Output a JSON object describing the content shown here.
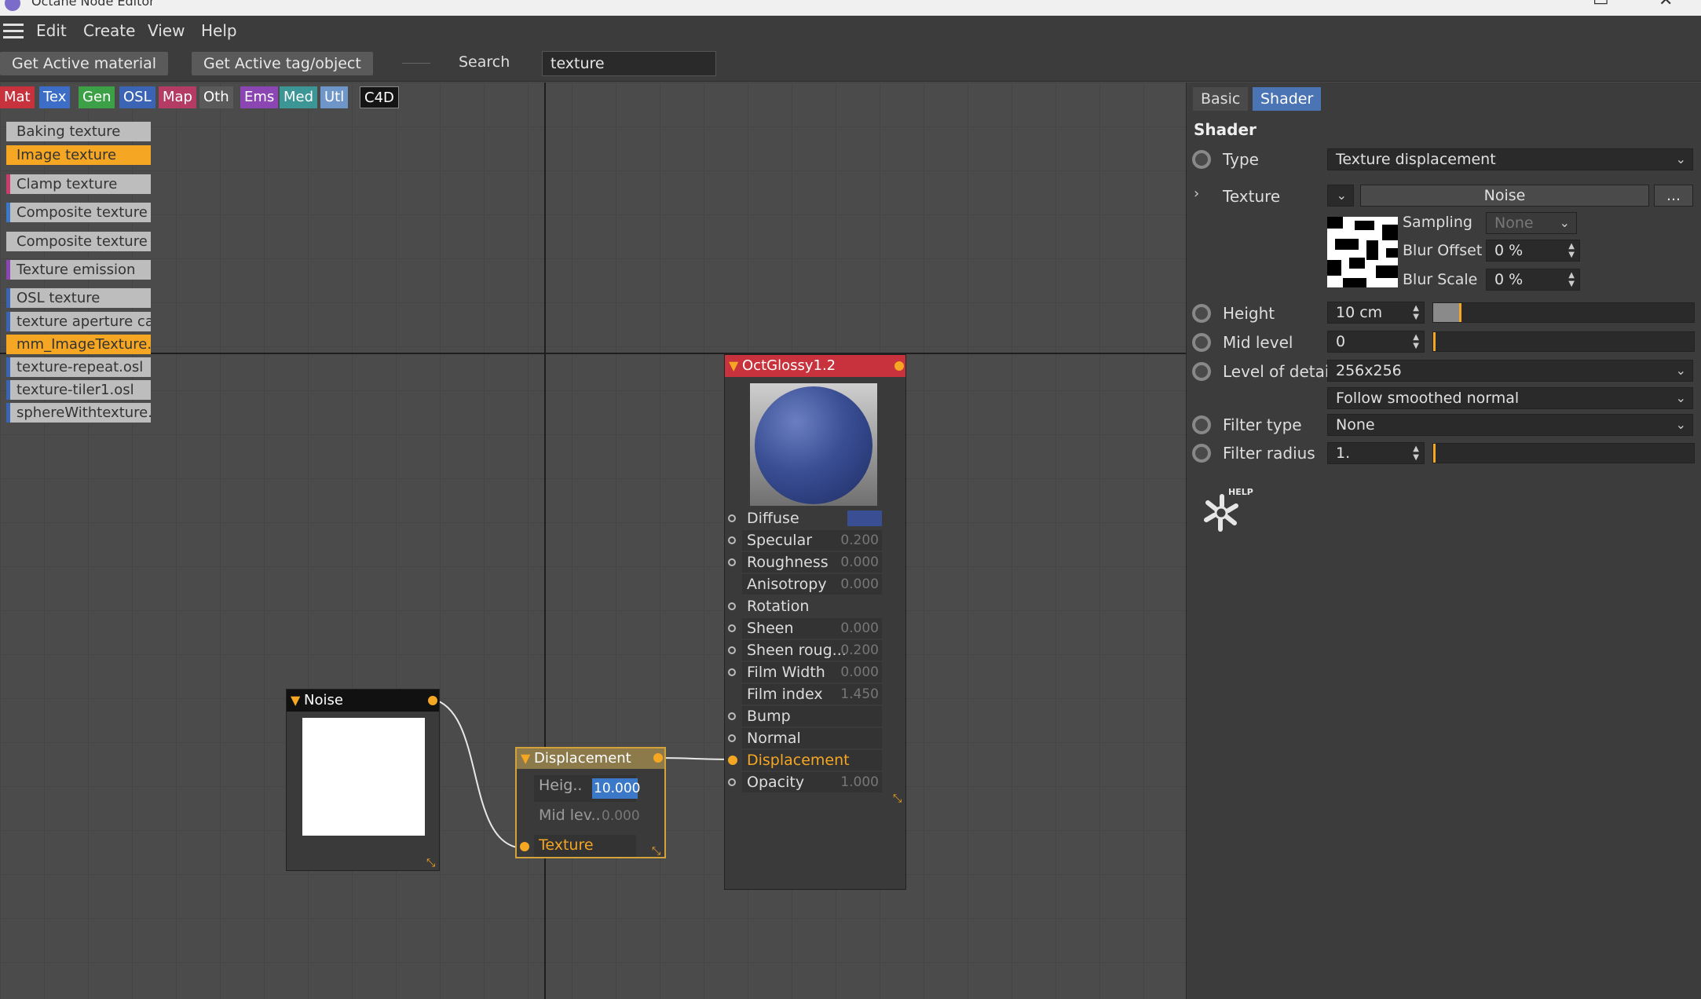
{
  "window": {
    "title": "Octane Node Editor"
  },
  "menu": [
    "Edit",
    "Create",
    "View",
    "Help"
  ],
  "toolbar": {
    "get_active_material": "Get Active material",
    "get_active_tag": "Get Active tag/object",
    "search_label": "Search",
    "search_value": "texture"
  },
  "categories": [
    {
      "label": "Mat",
      "color": "#c8323c"
    },
    {
      "label": "Tex",
      "color": "#3c6ec8"
    },
    {
      "label": "Gen",
      "color": "#3ca046"
    },
    {
      "label": "OSL",
      "color": "#3c64b4"
    },
    {
      "label": "Map",
      "color": "#b43c64"
    },
    {
      "label": "Oth",
      "color": "#5a5a5a"
    },
    {
      "label": "Ems",
      "color": "#8c46b4"
    },
    {
      "label": "Med",
      "color": "#3c9696"
    },
    {
      "label": "Utl",
      "color": "#6e96c8"
    },
    {
      "label": "C4D",
      "color": "#141414"
    }
  ],
  "node_list": [
    {
      "label": "Baking texture",
      "accent": ""
    },
    {
      "label": "Image texture",
      "accent": "#f5a623"
    },
    {
      "label": "Clamp texture",
      "accent": "#c83c6e"
    },
    {
      "label": "Composite texture",
      "accent": "#3c78c8"
    },
    {
      "label": "Composite texture",
      "accent": ""
    },
    {
      "label": "Texture emission",
      "accent": "#8c46b4"
    },
    {
      "label": "OSL texture",
      "accent": "#3c64b4"
    },
    {
      "label": "texture aperture ca",
      "accent": "#3c64b4"
    },
    {
      "label": "mm_ImageTexture.c",
      "accent": "#f5a623"
    },
    {
      "label": "texture-repeat.osl",
      "accent": "#3c64b4"
    },
    {
      "label": "texture-tiler1.osl",
      "accent": "#3c64b4"
    },
    {
      "label": "sphereWithtexture.t",
      "accent": "#3c64b4"
    }
  ],
  "nodes": {
    "noise": {
      "title": "Noise"
    },
    "displacement": {
      "title": "Displacement",
      "rows": [
        {
          "label": "Heig..",
          "value": "10.000"
        },
        {
          "label": "Mid lev..",
          "value": "0.000"
        },
        {
          "label": "Texture",
          "value": ""
        }
      ]
    },
    "glossy": {
      "title": "OctGlossy1.2",
      "rows": [
        {
          "label": "Diffuse",
          "value": ""
        },
        {
          "label": "Specular",
          "value": "0.200"
        },
        {
          "label": "Roughness",
          "value": "0.000"
        },
        {
          "label": "Anisotropy",
          "value": "0.000"
        },
        {
          "label": "Rotation",
          "value": ""
        },
        {
          "label": "Sheen",
          "value": "0.000"
        },
        {
          "label": "Sheen roug...",
          "value": "0.200"
        },
        {
          "label": "Film Width",
          "value": "0.000"
        },
        {
          "label": "Film index",
          "value": "1.450"
        },
        {
          "label": "Bump",
          "value": ""
        },
        {
          "label": "Normal",
          "value": ""
        },
        {
          "label": "Displacement",
          "value": ""
        },
        {
          "label": "Opacity",
          "value": "1.000"
        }
      ]
    }
  },
  "panel": {
    "tabs": [
      "Basic",
      "Shader"
    ],
    "section": "Shader",
    "type_label": "Type",
    "type_value": "Texture displacement",
    "texture_label": "Texture",
    "texture_value": "Noise",
    "texture_more": "...",
    "sampling_label": "Sampling",
    "sampling_value": "None",
    "blur_offset_label": "Blur Offset",
    "blur_offset_value": "0 %",
    "blur_scale_label": "Blur Scale",
    "blur_scale_value": "0 %",
    "height_label": "Height",
    "height_value": "10 cm",
    "height_fill": 0.1,
    "mid_label": "Mid level",
    "mid_value": "0",
    "lod_label": "Level of detail",
    "lod_value": "256x256",
    "lod_mode": "Follow smoothed normal",
    "filter_type_label": "Filter type",
    "filter_type_value": "None",
    "filter_radius_label": "Filter radius",
    "filter_radius_value": "1.",
    "help_label": "HELP"
  }
}
